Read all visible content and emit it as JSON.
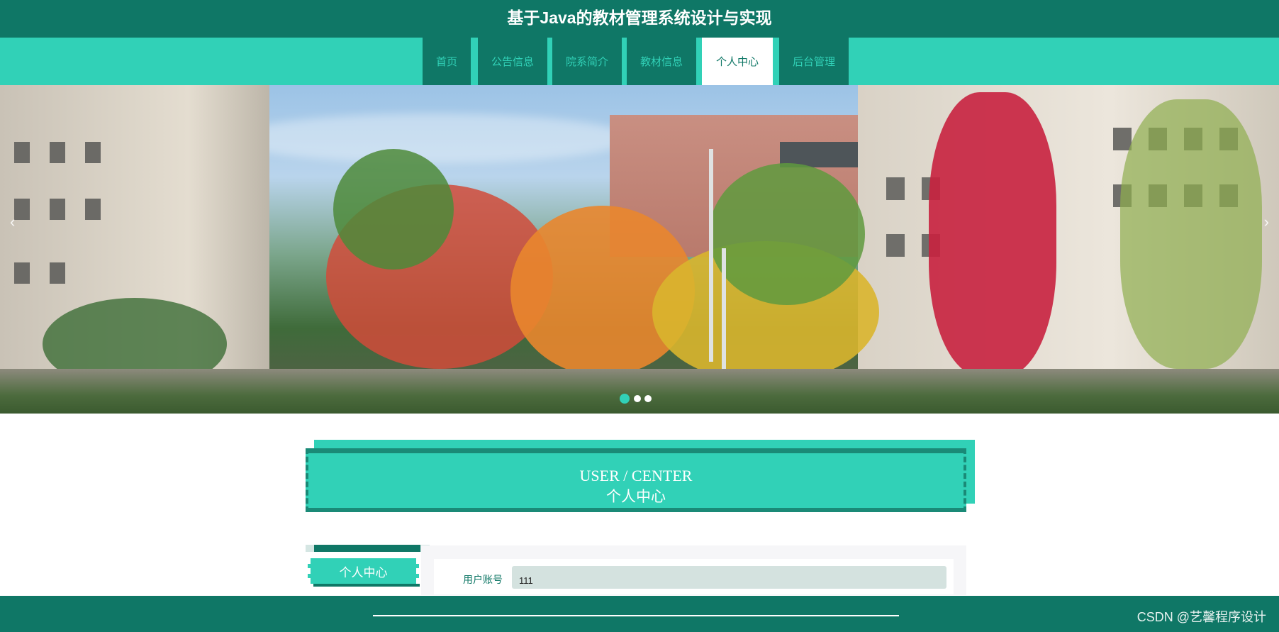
{
  "header": {
    "title": "基于Java的教材管理系统设计与实现"
  },
  "nav": {
    "items": [
      {
        "label": "首页"
      },
      {
        "label": "公告信息"
      },
      {
        "label": "院系简介"
      },
      {
        "label": "教材信息"
      },
      {
        "label": "个人中心",
        "active": true
      },
      {
        "label": "后台管理"
      }
    ]
  },
  "banner": {
    "prev_icon": "‹",
    "next_icon": "›",
    "slide_count": 3,
    "active_slide": 1
  },
  "section": {
    "title_en": "USER / CENTER",
    "title_cn": "个人中心"
  },
  "sidebar": {
    "items": [
      {
        "label": "个人中心"
      }
    ]
  },
  "form": {
    "fields": [
      {
        "label": "用户账号",
        "value": "111"
      }
    ]
  },
  "footer": {
    "watermark": "CSDN @艺馨程序设计"
  },
  "colors": {
    "primary_dark": "#0f7766",
    "primary": "#31d1b7",
    "input_bg": "#d4e2df"
  }
}
